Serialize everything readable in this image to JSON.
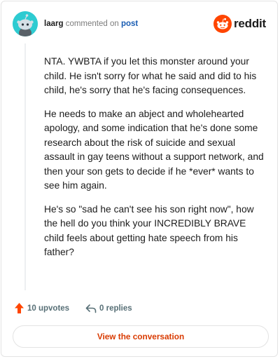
{
  "comment": {
    "author": "laarg",
    "action_text": "commented on",
    "post_link": "post",
    "paragraphs": [
      "NTA. YWBTA if you let this monster around your child. He isn't sorry for what he said and did to his child, he's sorry that he's facing consequences.",
      "He needs to make an abject and wholehearted apology, and some indication that he's done some research about the risk of suicide and sexual assault in gay teens without a support network, and then your son gets to decide if he *ever* wants to see him again.",
      "He's so \"sad he can't see his son right now\", how the hell do you think your INCREDIBLY BRAVE child feels about getting hate speech from his father?"
    ],
    "upvotes": "10 upvotes",
    "replies": "0 replies"
  },
  "brand": {
    "name": "reddit",
    "icon": "reddit-snoo-icon",
    "color": "#ff4500"
  },
  "footer": {
    "button_label": "View the conversation",
    "accent": "#d93a00"
  },
  "icons": {
    "avatar": "snoo-avatar-icon",
    "upvote": "upvote-arrow-icon",
    "reply": "reply-arrow-icon"
  }
}
